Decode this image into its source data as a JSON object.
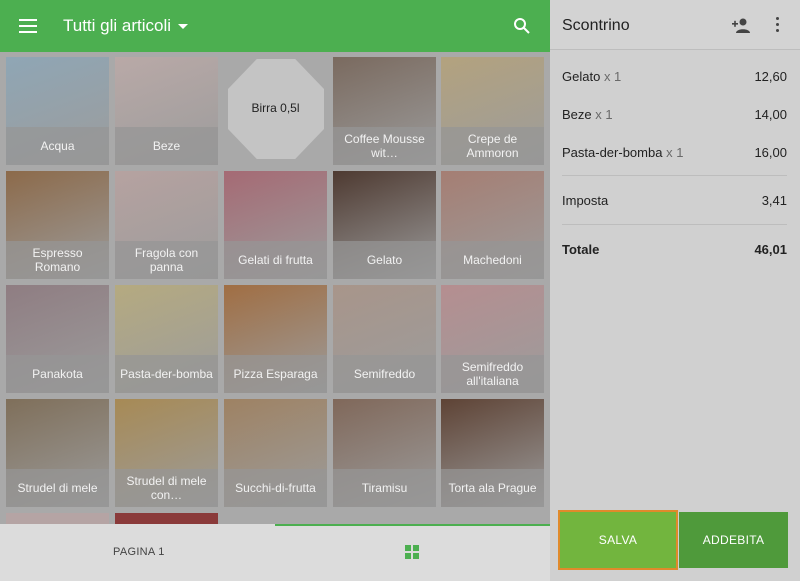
{
  "header": {
    "category_title": "Tutti gli articoli"
  },
  "products": [
    {
      "label": "Acqua",
      "color": "#8fa6b5"
    },
    {
      "label": "Beze",
      "color": "#b9a9a7"
    },
    {
      "label": "Birra 0,5l",
      "color": "#c4c4c4"
    },
    {
      "label": "Coffee Mousse wit…",
      "color": "#7a6a5f"
    },
    {
      "label": "Crepe de Ammoron",
      "color": "#b3a27e"
    },
    {
      "label": "Espresso Romano",
      "color": "#8c6a4a"
    },
    {
      "label": "Fragola con panna",
      "color": "#b6a2a0"
    },
    {
      "label": "Gelati di frutta",
      "color": "#a56a74"
    },
    {
      "label": "Gelato",
      "color": "#4e3a31"
    },
    {
      "label": "Machedoni",
      "color": "#a57e73"
    },
    {
      "label": "Panakota",
      "color": "#8f7d82"
    },
    {
      "label": "Pasta-der-bomba",
      "color": "#b5aa80"
    },
    {
      "label": "Pizza Esparaga",
      "color": "#a06e43"
    },
    {
      "label": "Semifreddo",
      "color": "#a8958a"
    },
    {
      "label": "Semifreddo all'italiana",
      "color": "#b58e90"
    },
    {
      "label": "Strudel di mele",
      "color": "#7f6f5a"
    },
    {
      "label": "Strudel di mele con…",
      "color": "#a78a55"
    },
    {
      "label": "Succhi-di-frutta",
      "color": "#9e8263"
    },
    {
      "label": "Tiramisu",
      "color": "#80685a"
    },
    {
      "label": "Torta ala Prague",
      "color": "#5e4335"
    }
  ],
  "footer": {
    "page_label": "PAGINA 1"
  },
  "receipt": {
    "title": "Scontrino",
    "items": [
      {
        "name": "Gelato",
        "qty": "x 1",
        "amount": "12,60"
      },
      {
        "name": "Beze",
        "qty": "x 1",
        "amount": "14,00"
      },
      {
        "name": "Pasta-der-bomba",
        "qty": "x 1",
        "amount": "16,00"
      }
    ],
    "tax_label": "Imposta",
    "tax_amount": "3,41",
    "total_label": "Totale",
    "total_amount": "46,01"
  },
  "actions": {
    "save_label": "SALVA",
    "charge_label": "ADDEBITA"
  },
  "colors": {
    "accent": "#4caf50",
    "save": "#72b53e",
    "charge": "#4f9a3b",
    "highlight": "#e08a2b"
  }
}
